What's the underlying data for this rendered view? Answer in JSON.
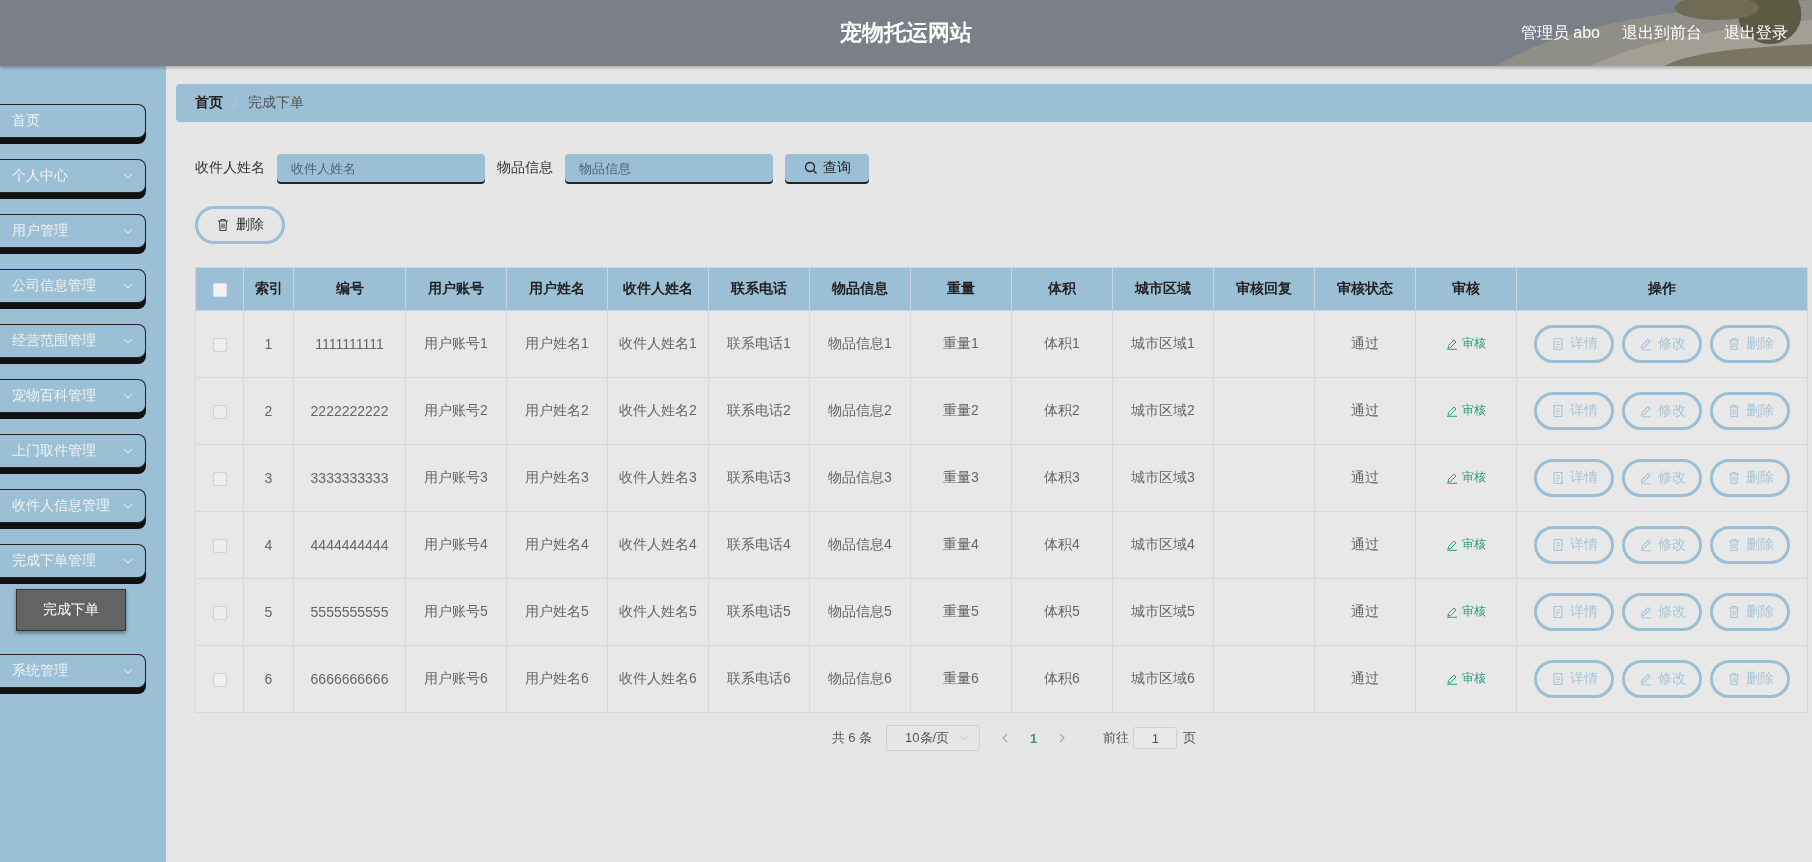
{
  "header": {
    "title": "宠物托运网站",
    "user": "管理员 abo",
    "links": [
      "退出到前台",
      "退出登录"
    ]
  },
  "sidebar": {
    "items": [
      {
        "label": "首页",
        "kind": "link"
      },
      {
        "label": "个人中心",
        "kind": "menu"
      },
      {
        "label": "用户管理",
        "kind": "menu"
      },
      {
        "label": "公司信息管理",
        "kind": "menu"
      },
      {
        "label": "经营范围管理",
        "kind": "menu"
      },
      {
        "label": "宠物百科管理",
        "kind": "menu"
      },
      {
        "label": "上门取件管理",
        "kind": "menu"
      },
      {
        "label": "收件人信息管理",
        "kind": "menu"
      },
      {
        "label": "完成下单管理",
        "kind": "menu",
        "children": [
          {
            "label": "完成下单"
          }
        ]
      },
      {
        "label": "系统管理",
        "kind": "menu"
      }
    ]
  },
  "breadcrumb": [
    "首页",
    "完成下单"
  ],
  "search": {
    "fields": [
      {
        "label": "收件人姓名",
        "placeholder": "收件人姓名"
      },
      {
        "label": "物品信息",
        "placeholder": "物品信息"
      }
    ],
    "button": "查询"
  },
  "delete_button": "删除",
  "table": {
    "header_checkbox": {
      "checked": false
    },
    "columns": [
      "索引",
      "编号",
      "用户账号",
      "用户姓名",
      "收件人姓名",
      "联系电话",
      "物品信息",
      "重量",
      "体积",
      "城市区域",
      "审核回复",
      "审核状态",
      "审核",
      "操作"
    ],
    "rows": [
      {
        "checked": false,
        "cells": [
          "1",
          "1111111111",
          "用户账号1",
          "用户姓名1",
          "收件人姓名1",
          "联系电话1",
          "物品信息1",
          "重量1",
          "体积1",
          "城市区域1",
          "",
          "通过"
        ],
        "review": "审核",
        "actions": [
          "详情",
          "修改",
          "删除"
        ]
      },
      {
        "checked": false,
        "cells": [
          "2",
          "2222222222",
          "用户账号2",
          "用户姓名2",
          "收件人姓名2",
          "联系电话2",
          "物品信息2",
          "重量2",
          "体积2",
          "城市区域2",
          "",
          "通过"
        ],
        "review": "审核",
        "actions": [
          "详情",
          "修改",
          "删除"
        ]
      },
      {
        "checked": false,
        "cells": [
          "3",
          "3333333333",
          "用户账号3",
          "用户姓名3",
          "收件人姓名3",
          "联系电话3",
          "物品信息3",
          "重量3",
          "体积3",
          "城市区域3",
          "",
          "通过"
        ],
        "review": "审核",
        "actions": [
          "详情",
          "修改",
          "删除"
        ]
      },
      {
        "checked": false,
        "cells": [
          "4",
          "4444444444",
          "用户账号4",
          "用户姓名4",
          "收件人姓名4",
          "联系电话4",
          "物品信息4",
          "重量4",
          "体积4",
          "城市区域4",
          "",
          "通过"
        ],
        "review": "审核",
        "actions": [
          "详情",
          "修改",
          "删除"
        ]
      },
      {
        "checked": false,
        "cells": [
          "5",
          "5555555555",
          "用户账号5",
          "用户姓名5",
          "收件人姓名5",
          "联系电话5",
          "物品信息5",
          "重量5",
          "体积5",
          "城市区域5",
          "",
          "通过"
        ],
        "review": "审核",
        "actions": [
          "详情",
          "修改",
          "删除"
        ]
      },
      {
        "checked": false,
        "cells": [
          "6",
          "6666666666",
          "用户账号6",
          "用户姓名6",
          "收件人姓名6",
          "联系电话6",
          "物品信息6",
          "重量6",
          "体积6",
          "城市区域6",
          "",
          "通过"
        ],
        "review": "审核",
        "actions": [
          "详情",
          "修改",
          "删除"
        ]
      }
    ]
  },
  "pagination": {
    "total": "共 6 条",
    "page_size": "10条/页",
    "pages": [
      {
        "label": "1",
        "selected": true
      }
    ],
    "goto_label": "前往",
    "goto_value": "1",
    "goto_suffix": "页"
  }
}
